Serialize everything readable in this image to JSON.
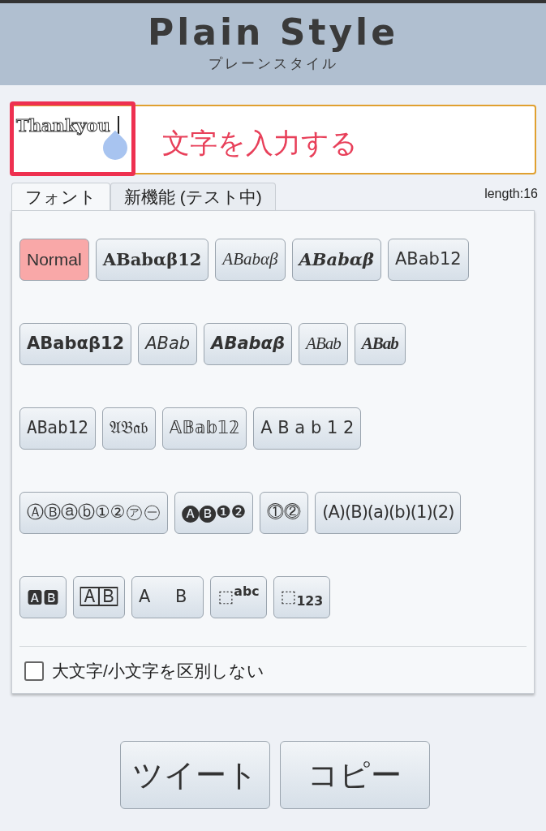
{
  "header": {
    "title": "Plain Style",
    "subtitle": "プレーンスタイル"
  },
  "input": {
    "value": "Thankyou"
  },
  "annotation": {
    "text": "文字を入力する"
  },
  "tabs": [
    {
      "label": "フォント",
      "selected": true
    },
    {
      "label": "新機能 (テスト中)",
      "selected": false
    }
  ],
  "length": "length:16",
  "style_rows": [
    [
      {
        "label": "Normal",
        "kind": "normal",
        "selected": true
      },
      {
        "label": "ABabαβ12",
        "kind": "serif-bold",
        "selected": false
      },
      {
        "label": "ABabαβ",
        "kind": "serif-italic",
        "selected": false
      },
      {
        "label": "ABabαβ",
        "kind": "serif-bold-italic",
        "selected": false
      },
      {
        "label": "ABab12",
        "kind": "sans",
        "selected": false
      }
    ],
    [
      {
        "label": "ABabαβ12",
        "kind": "sans-bold",
        "selected": false
      },
      {
        "label": "ABab",
        "kind": "sans-italic",
        "selected": false
      },
      {
        "label": "ABabαβ",
        "kind": "sans-bold-italic",
        "selected": false
      },
      {
        "label": "ABab",
        "kind": "script",
        "selected": false
      },
      {
        "label": "ABab",
        "kind": "script-bold",
        "selected": false
      }
    ],
    [
      {
        "label": "ABab12",
        "kind": "mono",
        "selected": false
      },
      {
        "label": "𝔄𝔅𝔞𝔟",
        "kind": "sans",
        "selected": false
      },
      {
        "label": "𝔸𝔹𝕒𝕓𝟙𝟚",
        "kind": "sans",
        "selected": false
      },
      {
        "label": "A B a b 1 2",
        "kind": "wide",
        "selected": false
      }
    ],
    [
      {
        "label": "ⒶⒷⓐⓑ①②㋐㊀",
        "kind": "sans",
        "selected": false
      },
      {
        "label": "🅐🅑❶❷",
        "kind": "sans",
        "selected": false
      },
      {
        "label": "⓵⓶",
        "kind": "sans",
        "selected": false
      },
      {
        "label": "(A)(B)(a)(b)(1)(2)",
        "kind": "narrow",
        "selected": false
      }
    ],
    [
      {
        "label": "🅰🅱",
        "kind": "sans",
        "selected": false
      },
      {
        "label": "🄰🄱",
        "kind": "sans",
        "selected": false
      },
      {
        "label": "A B",
        "kind": "outline",
        "selected": false
      },
      {
        "label": "⬚$^{abc}$",
        "kind": "rich",
        "selected": false
      },
      {
        "label": "⬚$_{123}$",
        "kind": "rich",
        "selected": false
      }
    ]
  ],
  "option": {
    "label": "大文字/小文字を区別しない",
    "checked": false
  },
  "buttons": [
    "ツイート",
    "コピー"
  ]
}
